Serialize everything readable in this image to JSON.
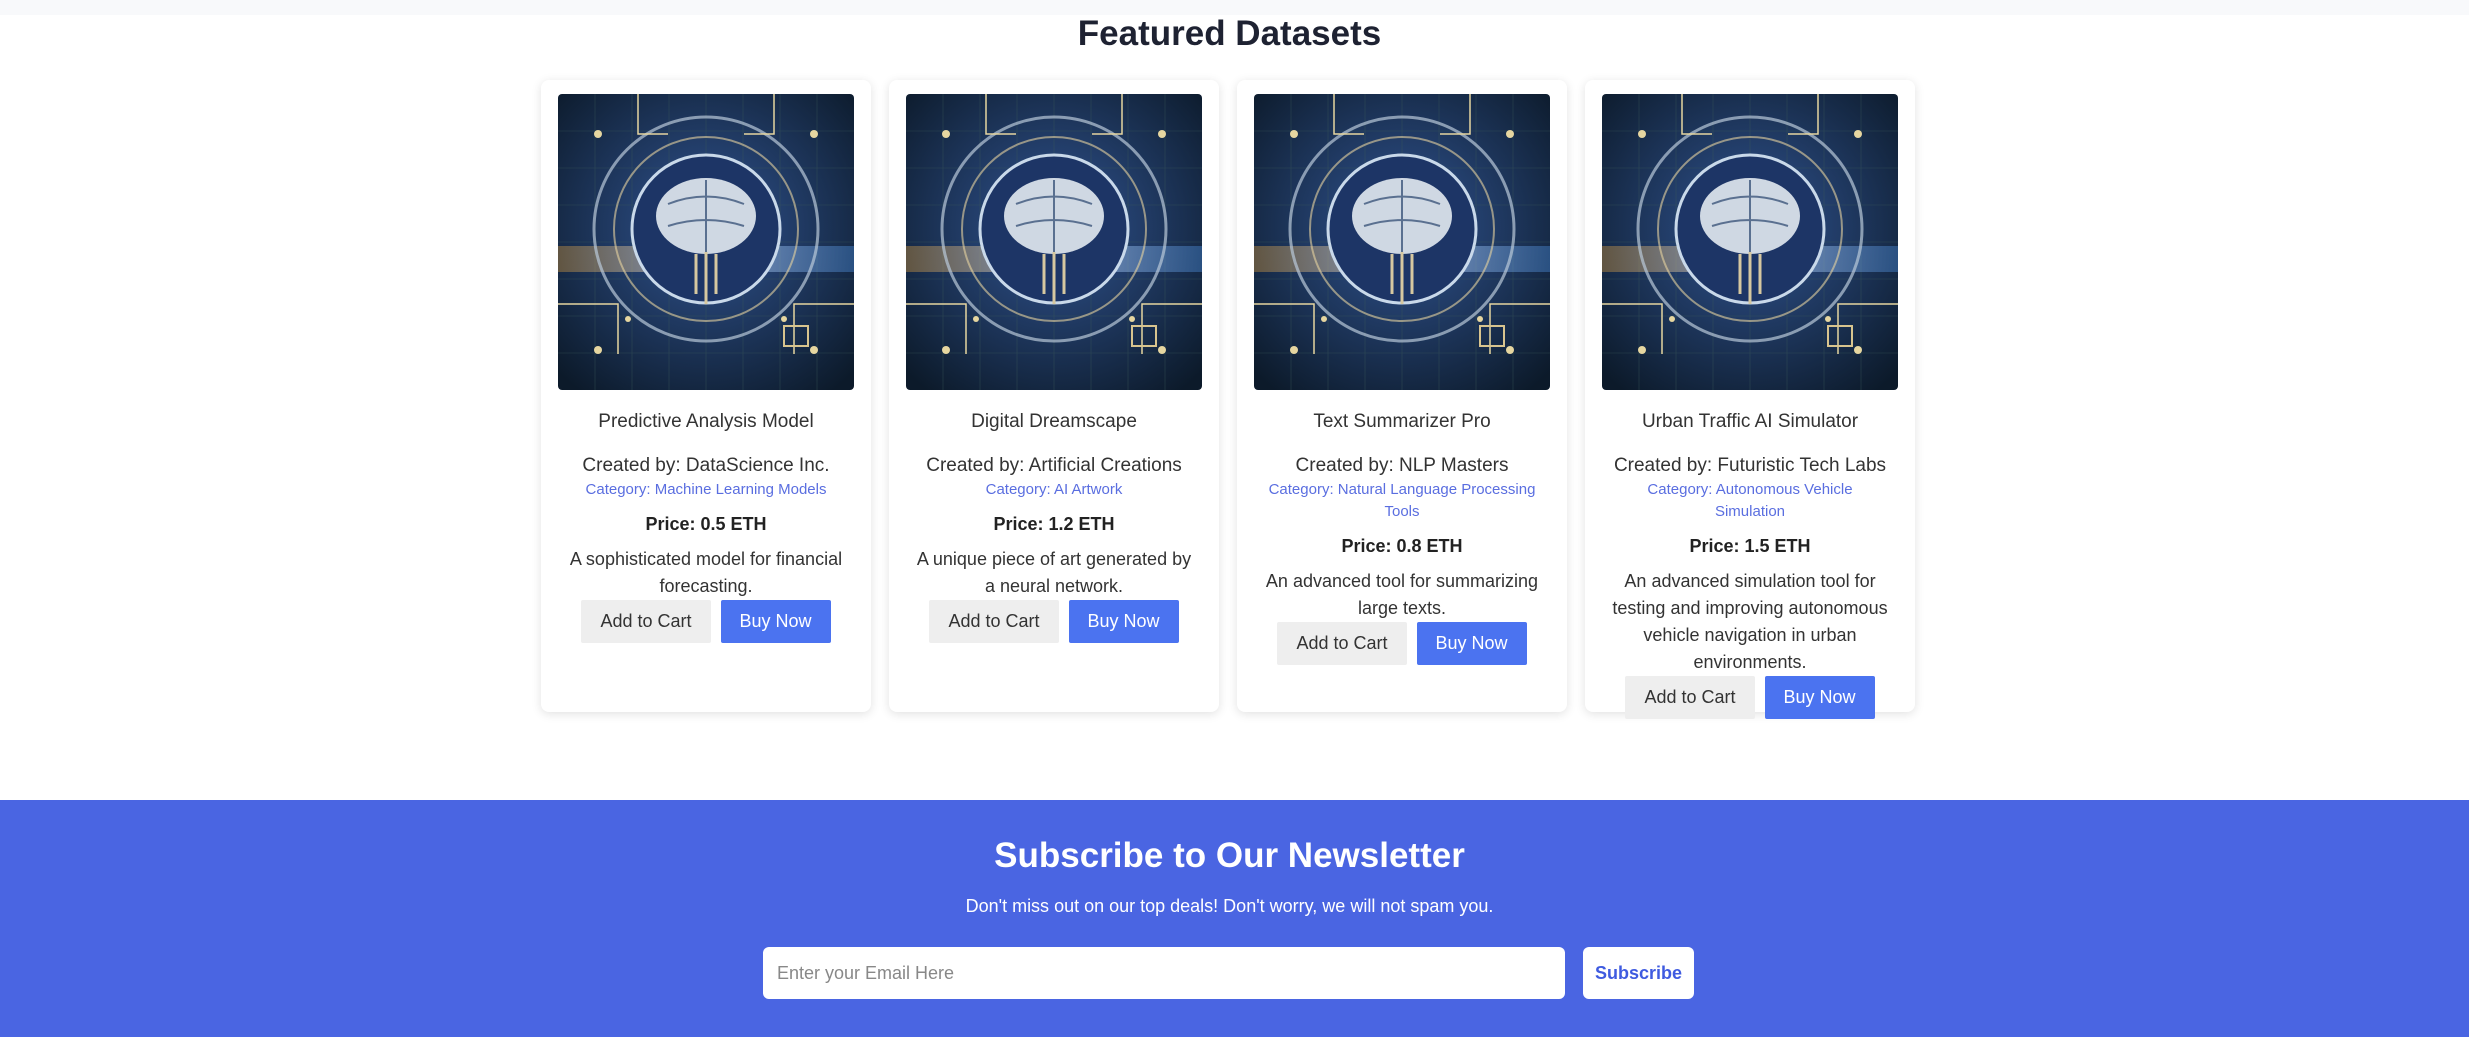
{
  "section": {
    "title": "Featured Datasets"
  },
  "products": [
    {
      "name": "Predictive Analysis Model",
      "creator": "Created by: DataScience Inc.",
      "category": "Category: Machine Learning Models",
      "price": "Price: 0.5 ETH",
      "description": "A sophisticated model for financial forecasting.",
      "image_icon": "ai-brain-circuit-image"
    },
    {
      "name": "Digital Dreamscape",
      "creator": "Created by: Artificial Creations",
      "category": "Category: AI Artwork",
      "price": "Price: 1.2 ETH",
      "description": "A unique piece of art generated by a neural network.",
      "image_icon": "ai-brain-circuit-image"
    },
    {
      "name": "Text Summarizer Pro",
      "creator": "Created by: NLP Masters",
      "category": "Category: Natural Language Processing Tools",
      "price": "Price: 0.8 ETH",
      "description": "An advanced tool for summarizing large texts.",
      "image_icon": "ai-brain-circuit-image"
    },
    {
      "name": "Urban Traffic AI Simulator",
      "creator": "Created by: Futuristic Tech Labs",
      "category": "Category: Autonomous Vehicle Simulation",
      "price": "Price: 1.5 ETH",
      "description": "An advanced simulation tool for testing and improving autonomous vehicle navigation in urban environments.",
      "image_icon": "ai-brain-circuit-image"
    }
  ],
  "actions": {
    "add_to_cart": "Add to Cart",
    "buy_now": "Buy Now"
  },
  "newsletter": {
    "title": "Subscribe to Our Newsletter",
    "subtitle": "Don't miss out on our top deals! Don't worry, we will not spam you.",
    "email_placeholder": "Enter your Email Here",
    "email_value": "",
    "subscribe_label": "Subscribe"
  },
  "colors": {
    "primary": "#4b73f0",
    "newsletter_bg": "#4a65e2",
    "category_text": "#5a6ee0"
  }
}
